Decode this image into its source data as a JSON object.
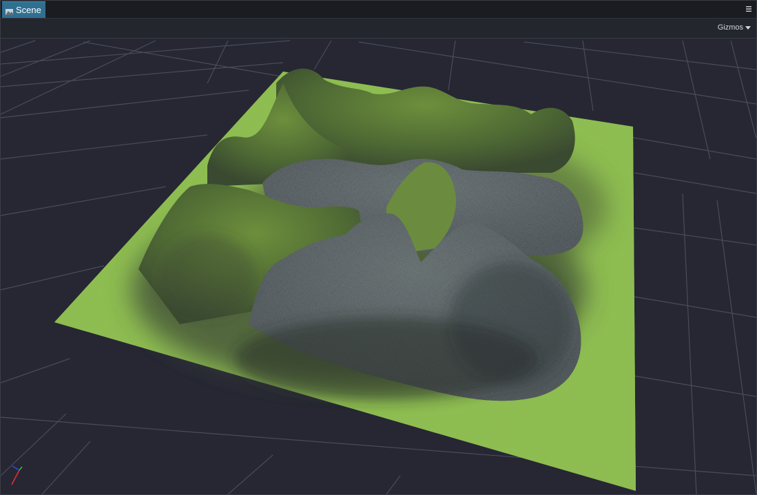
{
  "tab": {
    "label": "Scene",
    "icon": "scene-icon"
  },
  "panel": {
    "menu_icon": "hamburger-menu-icon"
  },
  "toolbar": {
    "gizmos_label": "Gizmos",
    "gizmos_icon": "caret-down-icon"
  },
  "viewport": {
    "content": "terrain",
    "colors": {
      "grass": "#8fbf4f",
      "grid": "#4a4c5a",
      "background": "#262733"
    }
  },
  "axis_gizmo": {
    "x_color": "#e03030",
    "y_color": "#30c030",
    "z_color": "#3050e0"
  }
}
